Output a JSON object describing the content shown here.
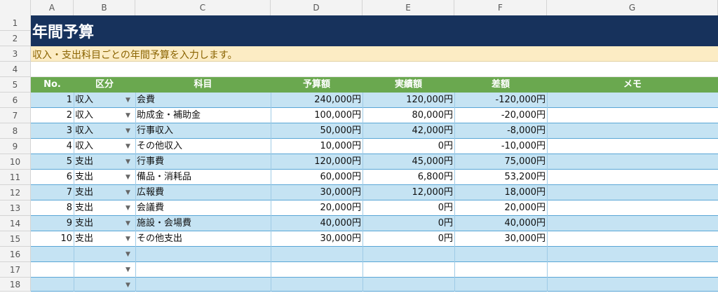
{
  "columns": [
    "A",
    "B",
    "C",
    "D",
    "E",
    "F",
    "G"
  ],
  "rows": [
    "1",
    "2",
    "3",
    "4",
    "5",
    "6",
    "7",
    "8",
    "9",
    "10",
    "11",
    "12",
    "13",
    "14",
    "15",
    "16",
    "17",
    "18"
  ],
  "title": "年間予算",
  "subtitle": "収入・支出科目ごとの年間予算を入力します。",
  "headers": {
    "no": "No.",
    "category": "区分",
    "item": "科目",
    "budget": "予算額",
    "actual": "実績額",
    "diff": "差額",
    "memo": "メモ"
  },
  "dropdown_glyph": "▼",
  "colors": {
    "title_bg": "#17325c",
    "subtitle_bg": "#fcecc4",
    "header_bg": "#6aa84f",
    "band_blue": "#c5e3f3"
  },
  "entries": [
    {
      "no": "1",
      "cat": "収入",
      "item": "会費",
      "budget": "240,000円",
      "actual": "120,000円",
      "diff": "-120,000円"
    },
    {
      "no": "2",
      "cat": "収入",
      "item": "助成金・補助金",
      "budget": "100,000円",
      "actual": "80,000円",
      "diff": "-20,000円"
    },
    {
      "no": "3",
      "cat": "収入",
      "item": "行事収入",
      "budget": "50,000円",
      "actual": "42,000円",
      "diff": "-8,000円"
    },
    {
      "no": "4",
      "cat": "収入",
      "item": "その他収入",
      "budget": "10,000円",
      "actual": "0円",
      "diff": "-10,000円"
    },
    {
      "no": "5",
      "cat": "支出",
      "item": "行事費",
      "budget": "120,000円",
      "actual": "45,000円",
      "diff": "75,000円"
    },
    {
      "no": "6",
      "cat": "支出",
      "item": "備品・消耗品",
      "budget": "60,000円",
      "actual": "6,800円",
      "diff": "53,200円"
    },
    {
      "no": "7",
      "cat": "支出",
      "item": "広報費",
      "budget": "30,000円",
      "actual": "12,000円",
      "diff": "18,000円"
    },
    {
      "no": "8",
      "cat": "支出",
      "item": "会議費",
      "budget": "20,000円",
      "actual": "0円",
      "diff": "20,000円"
    },
    {
      "no": "9",
      "cat": "支出",
      "item": "施設・会場費",
      "budget": "40,000円",
      "actual": "0円",
      "diff": "40,000円"
    },
    {
      "no": "10",
      "cat": "支出",
      "item": "その他支出",
      "budget": "30,000円",
      "actual": "0円",
      "diff": "30,000円"
    },
    {
      "no": "",
      "cat": "",
      "item": "",
      "budget": "",
      "actual": "",
      "diff": ""
    },
    {
      "no": "",
      "cat": "",
      "item": "",
      "budget": "",
      "actual": "",
      "diff": ""
    },
    {
      "no": "",
      "cat": "",
      "item": "",
      "budget": "",
      "actual": "",
      "diff": ""
    }
  ]
}
